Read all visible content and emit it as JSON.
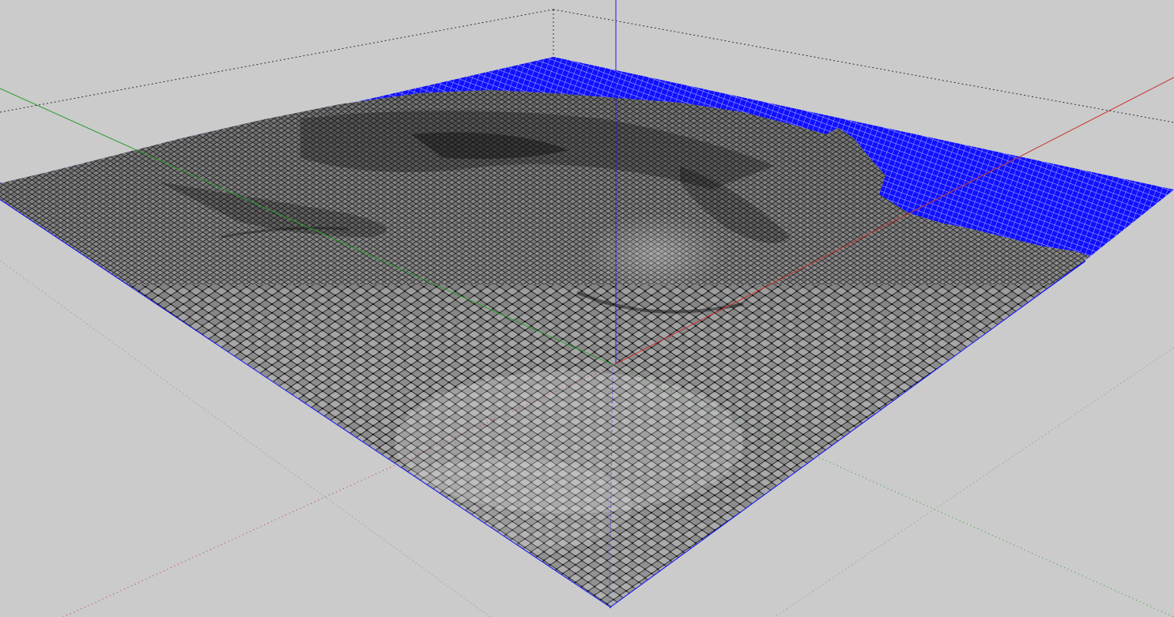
{
  "viewport": {
    "background_color": "#cbcbcb",
    "view": "3D perspective",
    "axes": {
      "x_axis_color": "#c83232",
      "y_axis_color": "#2a9a2a",
      "z_axis_color": "#2222dd"
    },
    "bounding_box_style": "dotted",
    "model": {
      "type": "terrain-mesh",
      "selected": true,
      "selection_color": "#0000ff",
      "surface_color": "#7a7a7a",
      "skirt_color": "#ececec"
    }
  }
}
